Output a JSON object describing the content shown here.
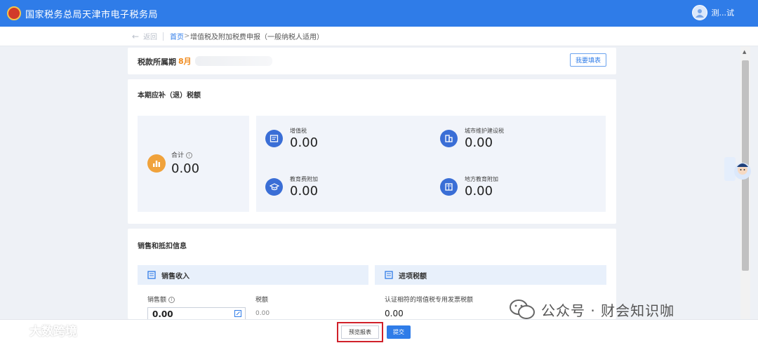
{
  "header": {
    "site_title": "国家税务总局天津市电子税务局",
    "user_name": "测...试"
  },
  "breadcrumb": {
    "back": "返回",
    "home": "首页",
    "separator": ">",
    "current": "增值税及附加税费申报（一般纳税人适用）"
  },
  "period": {
    "label": "税款所属期",
    "value": "8月",
    "fill_button": "我要填表"
  },
  "tax_summary": {
    "title": "本期应补（退）税额",
    "total_label": "合计",
    "total_value": "0.00",
    "items": [
      {
        "label": "增值税",
        "value": "0.00",
        "icon": "vat-doc-icon"
      },
      {
        "label": "城市维护建设税",
        "value": "0.00",
        "icon": "building-icon"
      },
      {
        "label": "教育费附加",
        "value": "0.00",
        "icon": "graduation-cap-icon"
      },
      {
        "label": "地方教育附加",
        "value": "0.00",
        "icon": "book-icon"
      }
    ]
  },
  "sales_section": {
    "title": "销售和抵扣信息",
    "sales_head": "销售收入",
    "sales_amount_label": "销售额",
    "sales_amount_value": "0.00",
    "tax_amount_label": "税额",
    "tax_amount_value": "0.00",
    "input_head": "进项税额",
    "input_label": "认证相符的增值税专用发票税额",
    "input_value": "0.00"
  },
  "footer": {
    "preview_button": "预览报表",
    "submit_button": "提交"
  },
  "watermarks": {
    "left": "大数跨境",
    "right": "公众号 · 财会知识咖"
  },
  "colors": {
    "header_bg": "#2f7ce8",
    "accent_orange": "#f08a1c",
    "icon_blue": "#3a6ed6",
    "highlight_red": "#d0202a"
  }
}
